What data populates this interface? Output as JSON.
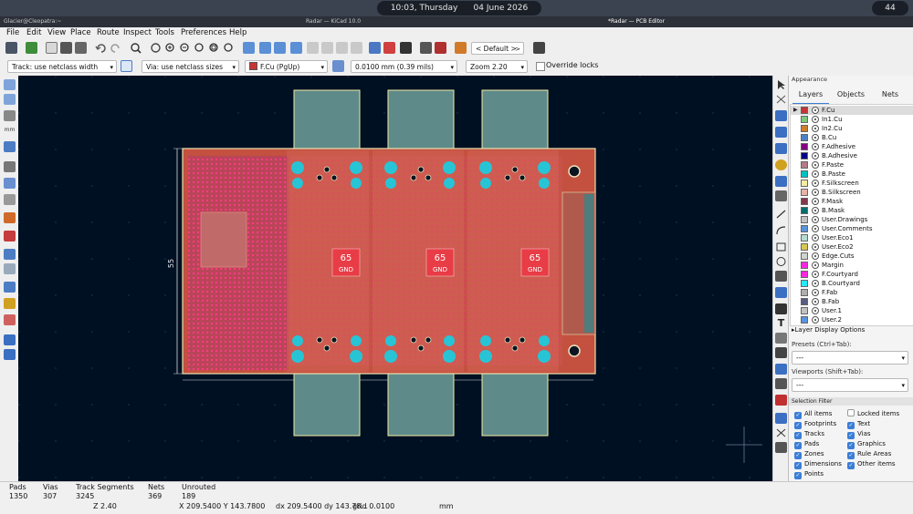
{
  "system_bar": {
    "left_user": "Glacier@Cleopatra:~",
    "time": "10:03, Thursday",
    "date": "04 June 2026",
    "badge": "44"
  },
  "window_titles": {
    "left": "Radar — KiCad 10.0",
    "right": "*Radar — PCB Editor"
  },
  "menu": [
    "File",
    "Edit",
    "View",
    "Place",
    "Route",
    "Inspect",
    "Tools",
    "Preferences",
    "Help"
  ],
  "toolbar": {
    "viewport_preset": "< Default >"
  },
  "toolbar2": {
    "track": "Track: use netclass width",
    "via": "Via: use netclass sizes",
    "layer": "F.Cu (PgUp)",
    "grid": "0.0100 mm (0.39 mils)",
    "zoom": "Zoom 2.20",
    "override_locks": "Override locks"
  },
  "board": {
    "dimension_label": "55",
    "gnd_labels": [
      {
        "num": "65",
        "net": "GND"
      },
      {
        "num": "65",
        "net": "GND"
      },
      {
        "num": "65",
        "net": "GND"
      }
    ]
  },
  "panel": {
    "title": "Appearance",
    "tabs": [
      "Layers",
      "Objects",
      "Nets"
    ],
    "layers": [
      {
        "name": "F.Cu",
        "color": "#c83434"
      },
      {
        "name": "In1.Cu",
        "color": "#7fc87f"
      },
      {
        "name": "In2.Cu",
        "color": "#ce7d2c"
      },
      {
        "name": "B.Cu",
        "color": "#4d7fc4"
      },
      {
        "name": "F.Adhesive",
        "color": "#84007f"
      },
      {
        "name": "B.Adhesive",
        "color": "#000084"
      },
      {
        "name": "F.Paste",
        "color": "#b57b87"
      },
      {
        "name": "B.Paste",
        "color": "#00c2c2"
      },
      {
        "name": "F.Silkscreen",
        "color": "#f2eda1"
      },
      {
        "name": "B.Silkscreen",
        "color": "#e8b2a7"
      },
      {
        "name": "F.Mask",
        "color": "#84384a"
      },
      {
        "name": "B.Mask",
        "color": "#026d6d"
      },
      {
        "name": "User.Drawings",
        "color": "#c2c2c2"
      },
      {
        "name": "User.Comments",
        "color": "#5994dc"
      },
      {
        "name": "User.Eco1",
        "color": "#b4dbd2"
      },
      {
        "name": "User.Eco2",
        "color": "#d8c852"
      },
      {
        "name": "Edge.Cuts",
        "color": "#d0d2cd"
      },
      {
        "name": "Margin",
        "color": "#ff26e2"
      },
      {
        "name": "F.Courtyard",
        "color": "#ff26e2"
      },
      {
        "name": "B.Courtyard",
        "color": "#26e9ff"
      },
      {
        "name": "F.Fab",
        "color": "#afafaf"
      },
      {
        "name": "B.Fab",
        "color": "#585d84"
      },
      {
        "name": "User.1",
        "color": "#c2c2c2"
      },
      {
        "name": "User.2",
        "color": "#5994dc"
      }
    ],
    "layer_display_options": "Layer Display Options",
    "presets_label": "Presets (Ctrl+Tab):",
    "presets_value": "---",
    "viewports_label": "Viewports (Shift+Tab):",
    "viewports_value": "---",
    "selection_filter_title": "Selection Filter",
    "filters_left": [
      "All items",
      "Footprints",
      "Tracks",
      "Pads",
      "Zones",
      "Dimensions",
      "Points"
    ],
    "filters_right": [
      "Locked items",
      "Text",
      "Vias",
      "Graphics",
      "Rule Areas",
      "Other items"
    ]
  },
  "status": {
    "pads_label": "Pads",
    "pads": "1350",
    "vias_label": "Vias",
    "vias": "307",
    "tracks_label": "Track Segments",
    "tracks": "3245",
    "nets_label": "Nets",
    "nets": "369",
    "unrouted_label": "Unrouted",
    "unrouted": "189",
    "zoom": "Z 2.40",
    "coords": "X 209.5400  Y 143.7800",
    "delta": "dx 209.5400  dy 143.78...",
    "grid": "grid 0.0100",
    "units": "mm"
  }
}
